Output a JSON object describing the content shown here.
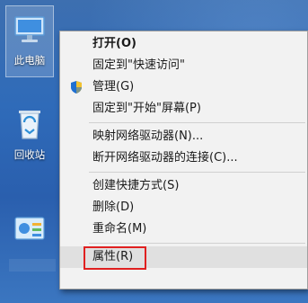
{
  "desktop": {
    "icons": [
      {
        "label": "此电脑",
        "icon": "computer-icon"
      },
      {
        "label": "回收站",
        "icon": "recycle-bin-icon"
      },
      {
        "label": "",
        "icon": "control-panel-icon"
      }
    ]
  },
  "menu": {
    "items": [
      {
        "label": "打开(O)",
        "bold": true
      },
      {
        "label": "固定到\"快速访问\""
      },
      {
        "label": "管理(G)",
        "icon": "uac-shield-icon"
      },
      {
        "label": "固定到\"开始\"屏幕(P)"
      },
      {
        "label": "映射网络驱动器(N)..."
      },
      {
        "label": "断开网络驱动器的连接(C)..."
      },
      {
        "label": "创建快捷方式(S)"
      },
      {
        "label": "删除(D)"
      },
      {
        "label": "重命名(M)"
      },
      {
        "label": "属性(R)",
        "highlighted": true
      }
    ]
  },
  "colors": {
    "highlight_border": "#e02020",
    "menu_background": "#f2f2f2",
    "desktop_blue": "#2f6bb9"
  }
}
